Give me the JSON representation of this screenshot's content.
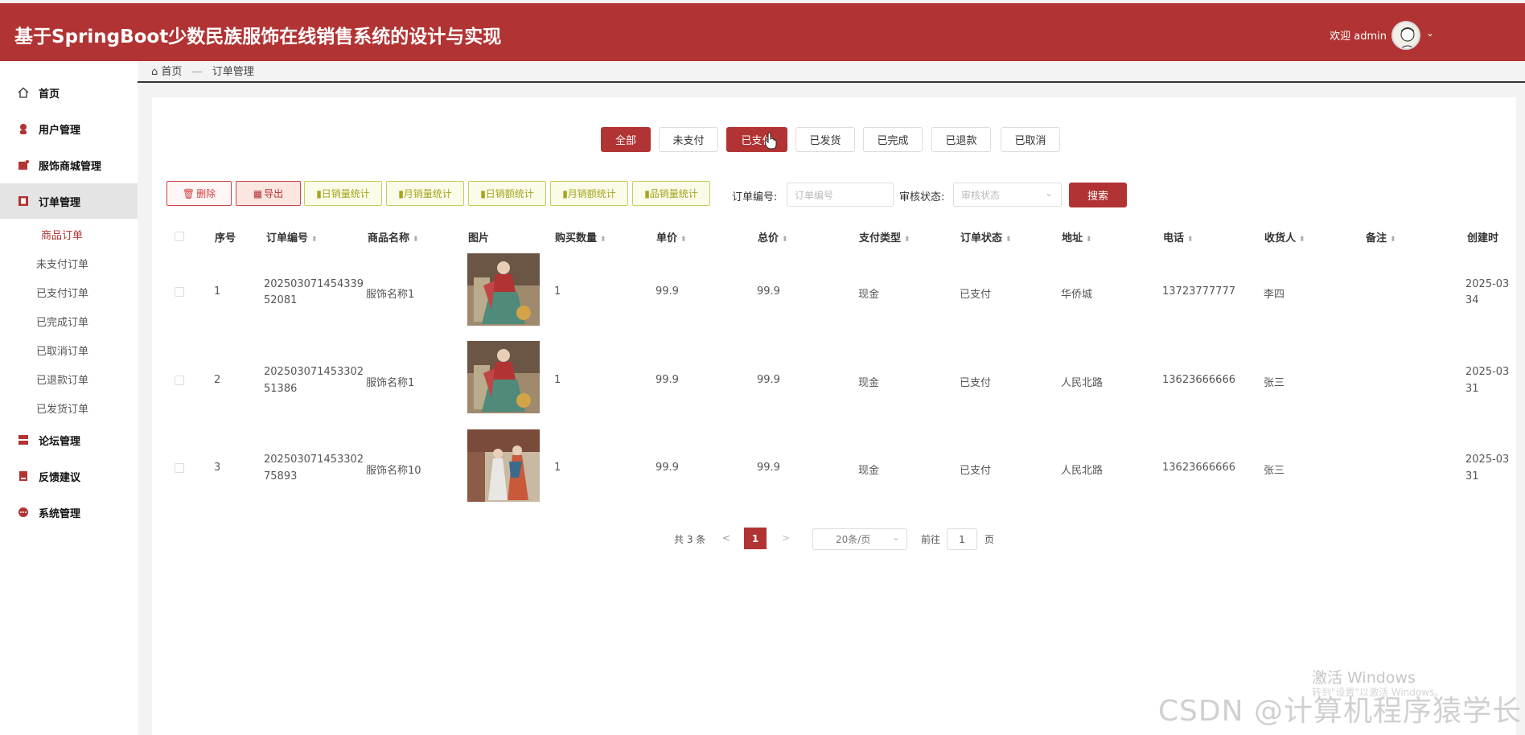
{
  "header": {
    "title": "基于SpringBoot少数民族服饰在线销售系统的设计与实现",
    "welcome": "欢迎 admin"
  },
  "sidebar": {
    "items": [
      {
        "label": "首页",
        "icon": "home-icon"
      },
      {
        "label": "用户管理",
        "icon": "user-icon"
      },
      {
        "label": "服饰商城管理",
        "icon": "shop-icon"
      },
      {
        "label": "订单管理",
        "icon": "order-icon"
      },
      {
        "label": "论坛管理",
        "icon": "forum-icon"
      },
      {
        "label": "反馈建议",
        "icon": "feedback-icon"
      },
      {
        "label": "系统管理",
        "icon": "system-icon"
      }
    ],
    "order_sub": [
      "商品订单",
      "未支付订单",
      "已支付订单",
      "已完成订单",
      "已取消订单",
      "已退款订单",
      "已发货订单"
    ]
  },
  "breadcrumb": {
    "home": "首页",
    "current": "订单管理"
  },
  "tabs": [
    "全部",
    "未支付",
    "已支付",
    "已发货",
    "已完成",
    "已退款",
    "已取消"
  ],
  "toolbar": {
    "delete": "删除",
    "export": "导出",
    "stats": [
      "日销量统计",
      "月销量统计",
      "日销额统计",
      "月销额统计",
      "品销量统计"
    ]
  },
  "filters": {
    "order_no_label": "订单编号:",
    "order_no_placeholder": "订单编号",
    "status_label": "审核状态:",
    "status_placeholder": "审核状态",
    "search": "搜索"
  },
  "table": {
    "headers": [
      "序号",
      "订单编号",
      "商品名称",
      "图片",
      "购买数量",
      "单价",
      "总价",
      "支付类型",
      "订单状态",
      "地址",
      "电话",
      "收货人",
      "备注",
      "创建时"
    ],
    "rows": [
      {
        "idx": "1",
        "order_no_1": "202503071454339",
        "order_no_2": "52081",
        "name": "服饰名称1",
        "qty": "1",
        "price": "99.9",
        "total": "99.9",
        "pay": "现金",
        "status": "已支付",
        "addr": "华侨城",
        "phone": "13723777777",
        "receiver": "李四",
        "note": "",
        "created_1": "2025-03",
        "created_2": "34"
      },
      {
        "idx": "2",
        "order_no_1": "202503071453302",
        "order_no_2": "51386",
        "name": "服饰名称1",
        "qty": "1",
        "price": "99.9",
        "total": "99.9",
        "pay": "现金",
        "status": "已支付",
        "addr": "人民北路",
        "phone": "13623666666",
        "receiver": "张三",
        "note": "",
        "created_1": "2025-03",
        "created_2": "31"
      },
      {
        "idx": "3",
        "order_no_1": "202503071453302",
        "order_no_2": "75893",
        "name": "服饰名称10",
        "qty": "1",
        "price": "99.9",
        "total": "99.9",
        "pay": "现金",
        "status": "已支付",
        "addr": "人民北路",
        "phone": "13623666666",
        "receiver": "张三",
        "note": "",
        "created_1": "2025-03",
        "created_2": "31"
      }
    ]
  },
  "pagination": {
    "total": "共 3 条",
    "prev": "<",
    "current": "1",
    "next": ">",
    "page_size": "20条/页",
    "goto_label": "前往",
    "goto_value": "1",
    "page_unit": "页"
  },
  "overlay": {
    "win_activate": "激活 Windows",
    "win_sub": "转到\"设置\"以激活 Windows。",
    "csdn": "CSDN @计算机程序猿学长"
  },
  "colors": {
    "accent": "#b23333",
    "stat_green": "#a2a61a"
  }
}
